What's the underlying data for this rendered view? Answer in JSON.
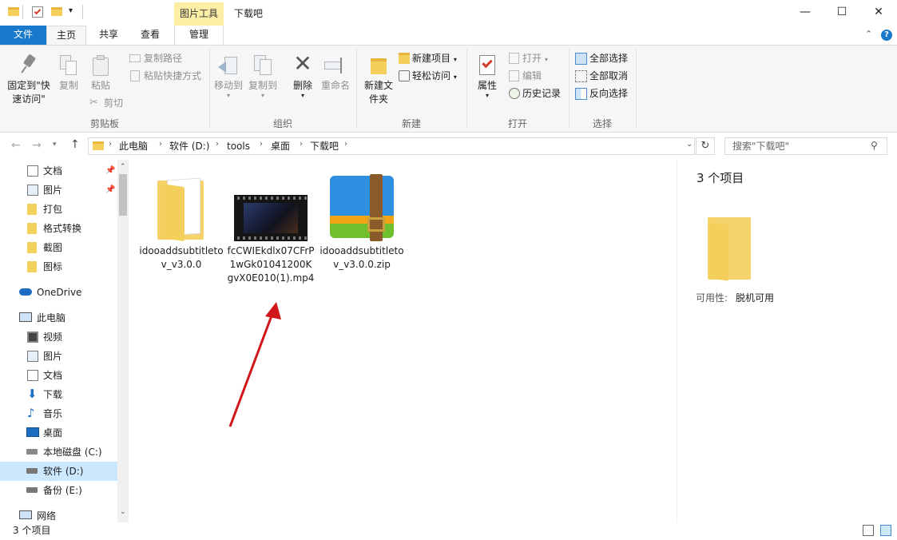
{
  "titlebar": {
    "context_tab": "图片工具",
    "window_title": "下载吧",
    "buttons": {
      "minimize": "—",
      "maximize": "☐",
      "close": "✕"
    }
  },
  "tabs": {
    "file": "文件",
    "home": "主页",
    "share": "共享",
    "view": "查看",
    "manage": "管理"
  },
  "ribbon": {
    "clipboard": {
      "pin": "固定到\"快速访问\"",
      "copy": "复制",
      "paste": "粘贴",
      "copy_path": "复制路径",
      "paste_shortcut": "粘贴快捷方式",
      "cut": "剪切",
      "label": "剪贴板"
    },
    "organize": {
      "move_to": "移动到",
      "copy_to": "复制到",
      "delete": "删除",
      "rename": "重命名",
      "label": "组织"
    },
    "new": {
      "new_folder": "新建文件夹",
      "new_item": "新建项目",
      "easy_access": "轻松访问",
      "label": "新建"
    },
    "open": {
      "properties": "属性",
      "open": "打开",
      "edit": "编辑",
      "history": "历史记录",
      "label": "打开"
    },
    "select": {
      "select_all": "全部选择",
      "select_none": "全部取消",
      "invert": "反向选择",
      "label": "选择"
    }
  },
  "address": {
    "crumbs": [
      "此电脑",
      "软件 (D:)",
      "tools",
      "桌面",
      "下载吧"
    ],
    "search_placeholder": "搜索\"下载吧\""
  },
  "nav": {
    "quick": [
      {
        "label": "文档",
        "pinned": true
      },
      {
        "label": "图片",
        "pinned": true
      },
      {
        "label": "打包"
      },
      {
        "label": "格式转换"
      },
      {
        "label": "截图"
      },
      {
        "label": "图标"
      }
    ],
    "onedrive": "OneDrive",
    "thispc": "此电脑",
    "pc_items": [
      "视频",
      "图片",
      "文档",
      "下载",
      "音乐",
      "桌面",
      "本地磁盘 (C:)",
      "软件 (D:)",
      "备份 (E:)"
    ],
    "network": "网络"
  },
  "files": [
    {
      "name": "idooaddsubtitletov_v3.0.0",
      "type": "folder"
    },
    {
      "name": "fcCWIEkdlx07CFrP1wGk01041200KgvX0E010(1).mp4",
      "type": "video"
    },
    {
      "name": "idooaddsubtitletov_v3.0.0.zip",
      "type": "zip"
    }
  ],
  "details": {
    "count": "3 个项目",
    "availability_label": "可用性:",
    "availability_value": "脱机可用"
  },
  "status": {
    "count": "3 个项目"
  },
  "colors": {
    "accent": "#1979ca",
    "selected": "#cce8ff",
    "arrow": "#d0161b"
  }
}
